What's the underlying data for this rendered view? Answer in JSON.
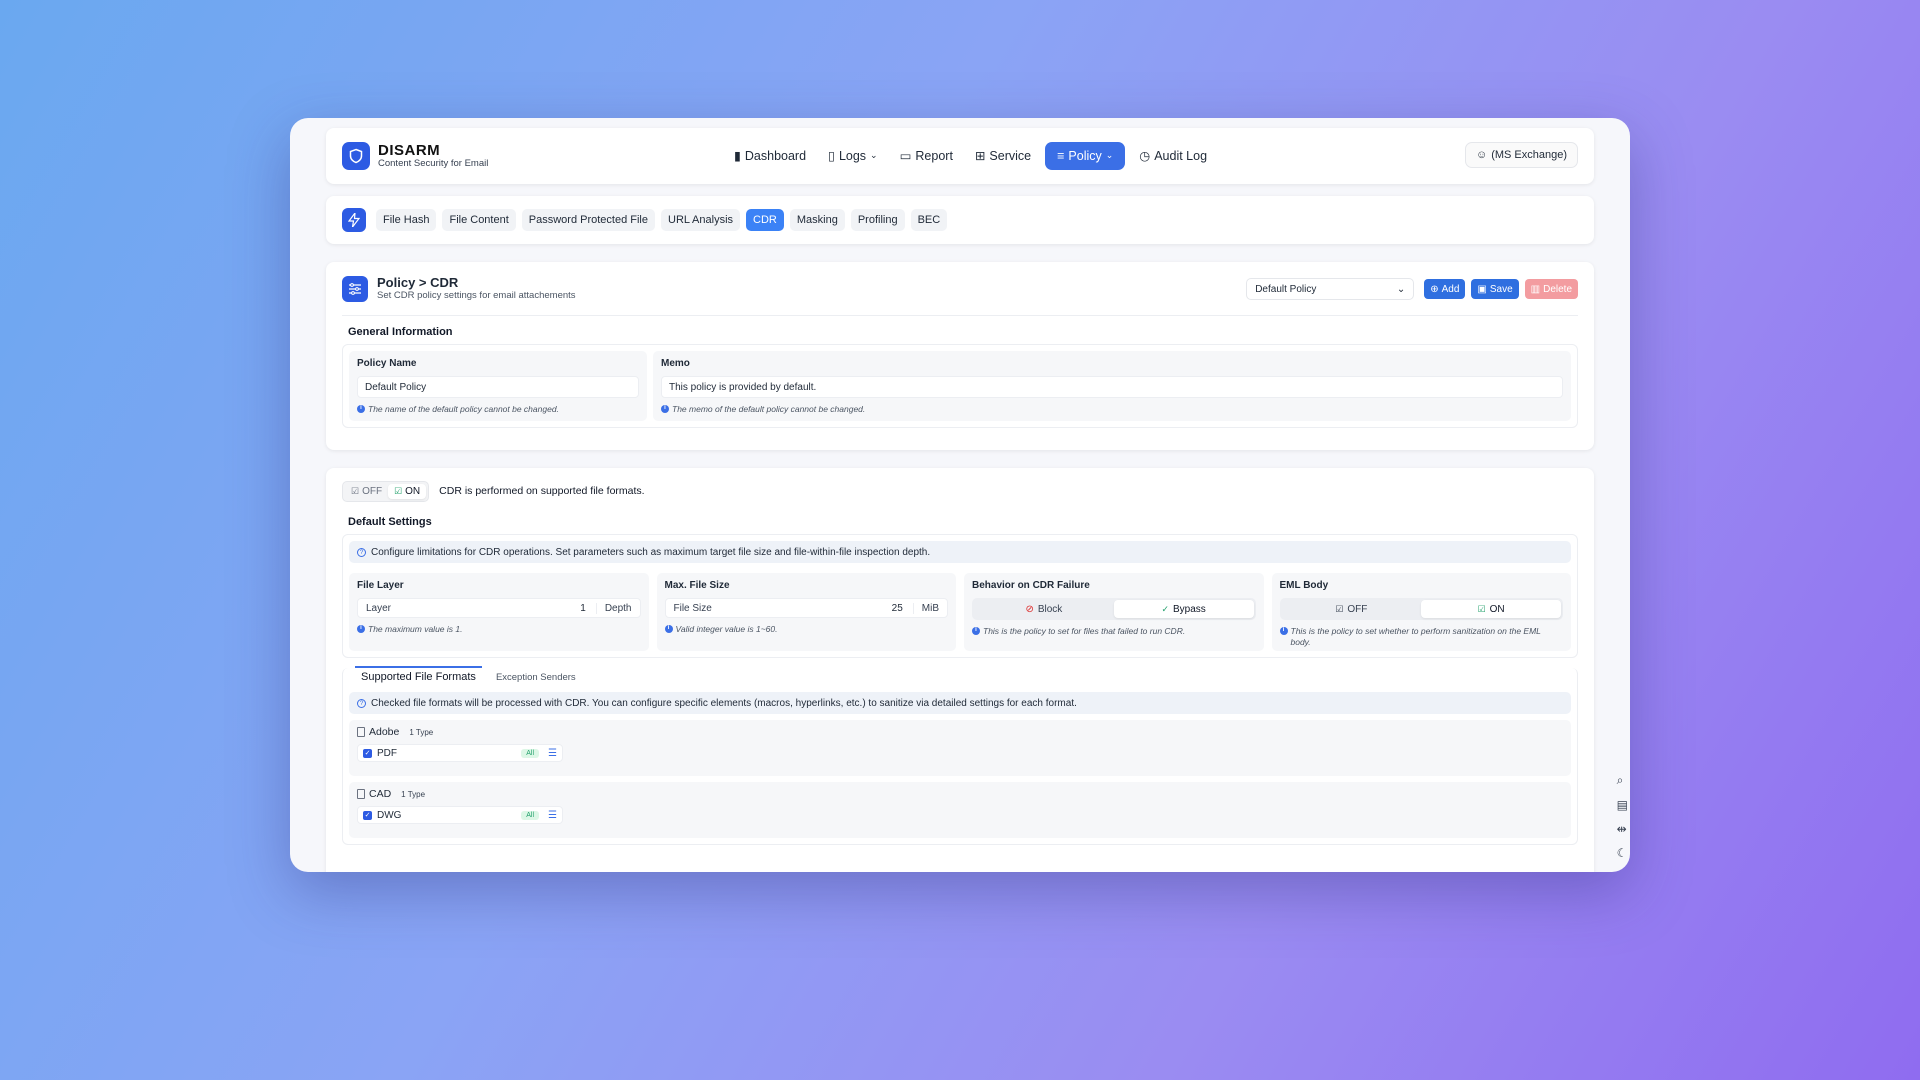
{
  "brand": {
    "name": "DISARM",
    "tagline": "Content Security for Email"
  },
  "nav": {
    "items": [
      {
        "label": "Dashboard",
        "icon": "bar-chart-icon"
      },
      {
        "label": "Logs",
        "icon": "document-icon",
        "dropdown": true
      },
      {
        "label": "Report",
        "icon": "report-icon"
      },
      {
        "label": "Service",
        "icon": "windows-icon"
      },
      {
        "label": "Policy",
        "icon": "sliders-icon",
        "dropdown": true,
        "active": true
      },
      {
        "label": "Audit Log",
        "icon": "clock-icon"
      }
    ],
    "user": "(MS Exchange)"
  },
  "subnav": {
    "tabs": [
      "File Hash",
      "File Content",
      "Password Protected File",
      "URL Analysis",
      "CDR",
      "Masking",
      "Profiling",
      "BEC"
    ],
    "active": "CDR"
  },
  "policy_header": {
    "title": "Policy > CDR",
    "subtitle": "Set CDR policy settings for email attachements",
    "selected_policy": "Default Policy",
    "add_label": "Add",
    "save_label": "Save",
    "delete_label": "Delete"
  },
  "general_info": {
    "section_title": "General Information",
    "policy_name_label": "Policy Name",
    "policy_name_value": "Default Policy",
    "policy_name_hint": "The name of the default policy cannot be changed.",
    "memo_label": "Memo",
    "memo_value": "This policy is provided by default.",
    "memo_hint": "The memo of the default policy cannot be changed."
  },
  "cdr_toggle": {
    "off_label": "OFF",
    "on_label": "ON",
    "state": "ON",
    "description": "CDR is performed on supported file formats."
  },
  "default_settings": {
    "section_title": "Default Settings",
    "info": "Configure limitations for CDR operations. Set parameters such as maximum target file size and file-within-file inspection depth.",
    "file_layer": {
      "label": "File Layer",
      "placeholder": "Layer",
      "value": "1",
      "unit": "Depth",
      "hint": "The maximum value is 1."
    },
    "max_file_size": {
      "label": "Max. File Size",
      "placeholder": "File Size",
      "value": "25",
      "unit": "MiB",
      "hint": "Valid integer value is 1~60."
    },
    "failure_behavior": {
      "label": "Behavior on CDR Failure",
      "block_label": "Block",
      "bypass_label": "Bypass",
      "selected": "Bypass",
      "hint": "This is the policy to set for files that failed to run CDR."
    },
    "eml_body": {
      "label": "EML Body",
      "off_label": "OFF",
      "on_label": "ON",
      "selected": "ON",
      "hint": "This is the policy to set whether to perform sanitization on the EML body."
    }
  },
  "formats": {
    "tab_active": "Supported File Formats",
    "tab_other": "Exception Senders",
    "info": "Checked file formats will be processed with CDR. You can configure specific elements (macros, hyperlinks, etc.) to sanitize via detailed settings for each format.",
    "groups": [
      {
        "name": "Adobe",
        "count": "1 Type",
        "items": [
          {
            "name": "PDF",
            "badge": "All",
            "checked": true
          }
        ]
      },
      {
        "name": "CAD",
        "count": "1 Type",
        "items": [
          {
            "name": "DWG",
            "badge": "All",
            "checked": true
          }
        ]
      }
    ]
  },
  "colors": {
    "primary": "#2d5be3",
    "active_tab": "#3b82f6",
    "danger": "#f39ca0",
    "success": "#22a06b"
  }
}
